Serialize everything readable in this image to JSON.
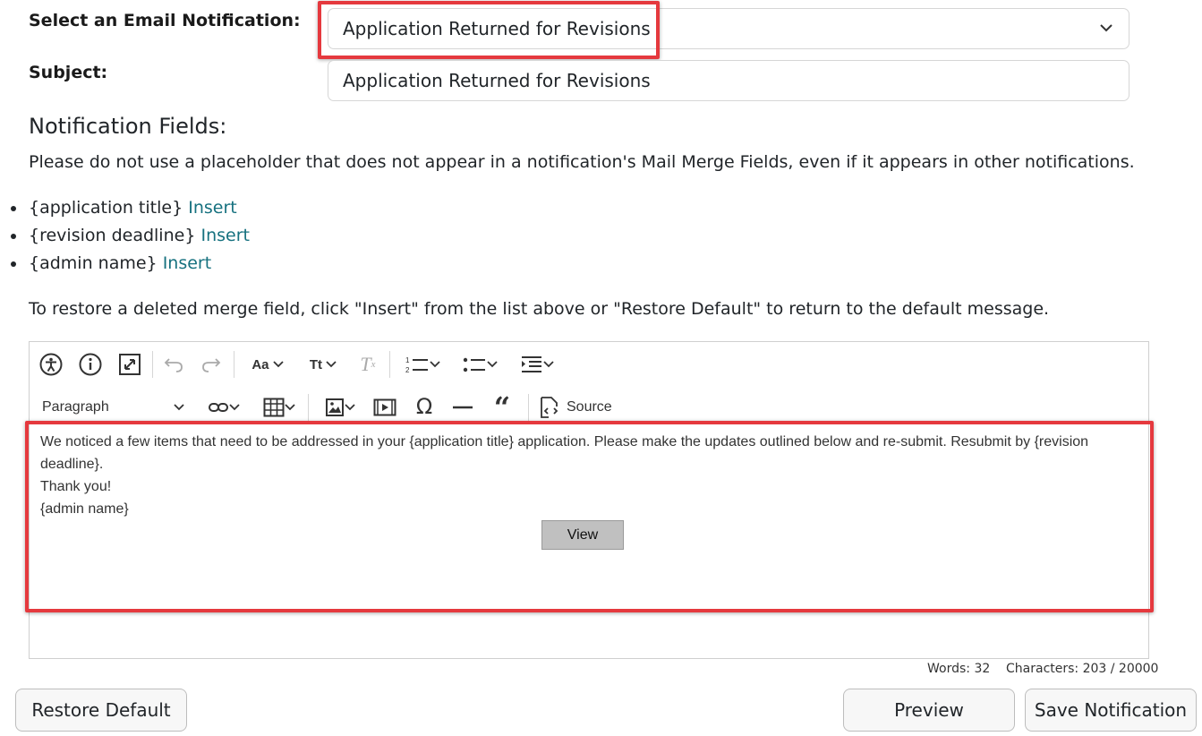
{
  "form": {
    "notification_label": "Select an Email Notification:",
    "notification_selected": "Application Returned for Revisions",
    "subject_label": "Subject:",
    "subject_value": "Application Returned for Revisions"
  },
  "fields_section": {
    "heading": "Notification Fields:",
    "note": "Please do not use a placeholder that does not appear in a notification's Mail Merge Fields, even if it appears in other notifications.",
    "items": [
      {
        "field": "{application title}",
        "action": "Insert"
      },
      {
        "field": "{revision deadline}",
        "action": "Insert"
      },
      {
        "field": "{admin name}",
        "action": "Insert"
      }
    ],
    "restore_hint": "To restore a deleted merge field, click \"Insert\" from the list above or \"Restore Default\" to return to the default message."
  },
  "toolbar": {
    "block_format": "Paragraph",
    "source_label": "Source"
  },
  "editor": {
    "line1": "We noticed a few items that need to be addressed in your {application title} application. Please make the updates outlined below and re-submit. Resubmit by {revision deadline}.",
    "line2": "Thank you!",
    "line3": "{admin name}",
    "view_button": "View",
    "words": "Words: 32",
    "characters": "Characters: 203 / 20000"
  },
  "buttons": {
    "restore_default": "Restore Default",
    "preview": "Preview",
    "save": "Save Notification"
  },
  "colors": {
    "highlight": "#e5393e",
    "link": "#16717f"
  }
}
